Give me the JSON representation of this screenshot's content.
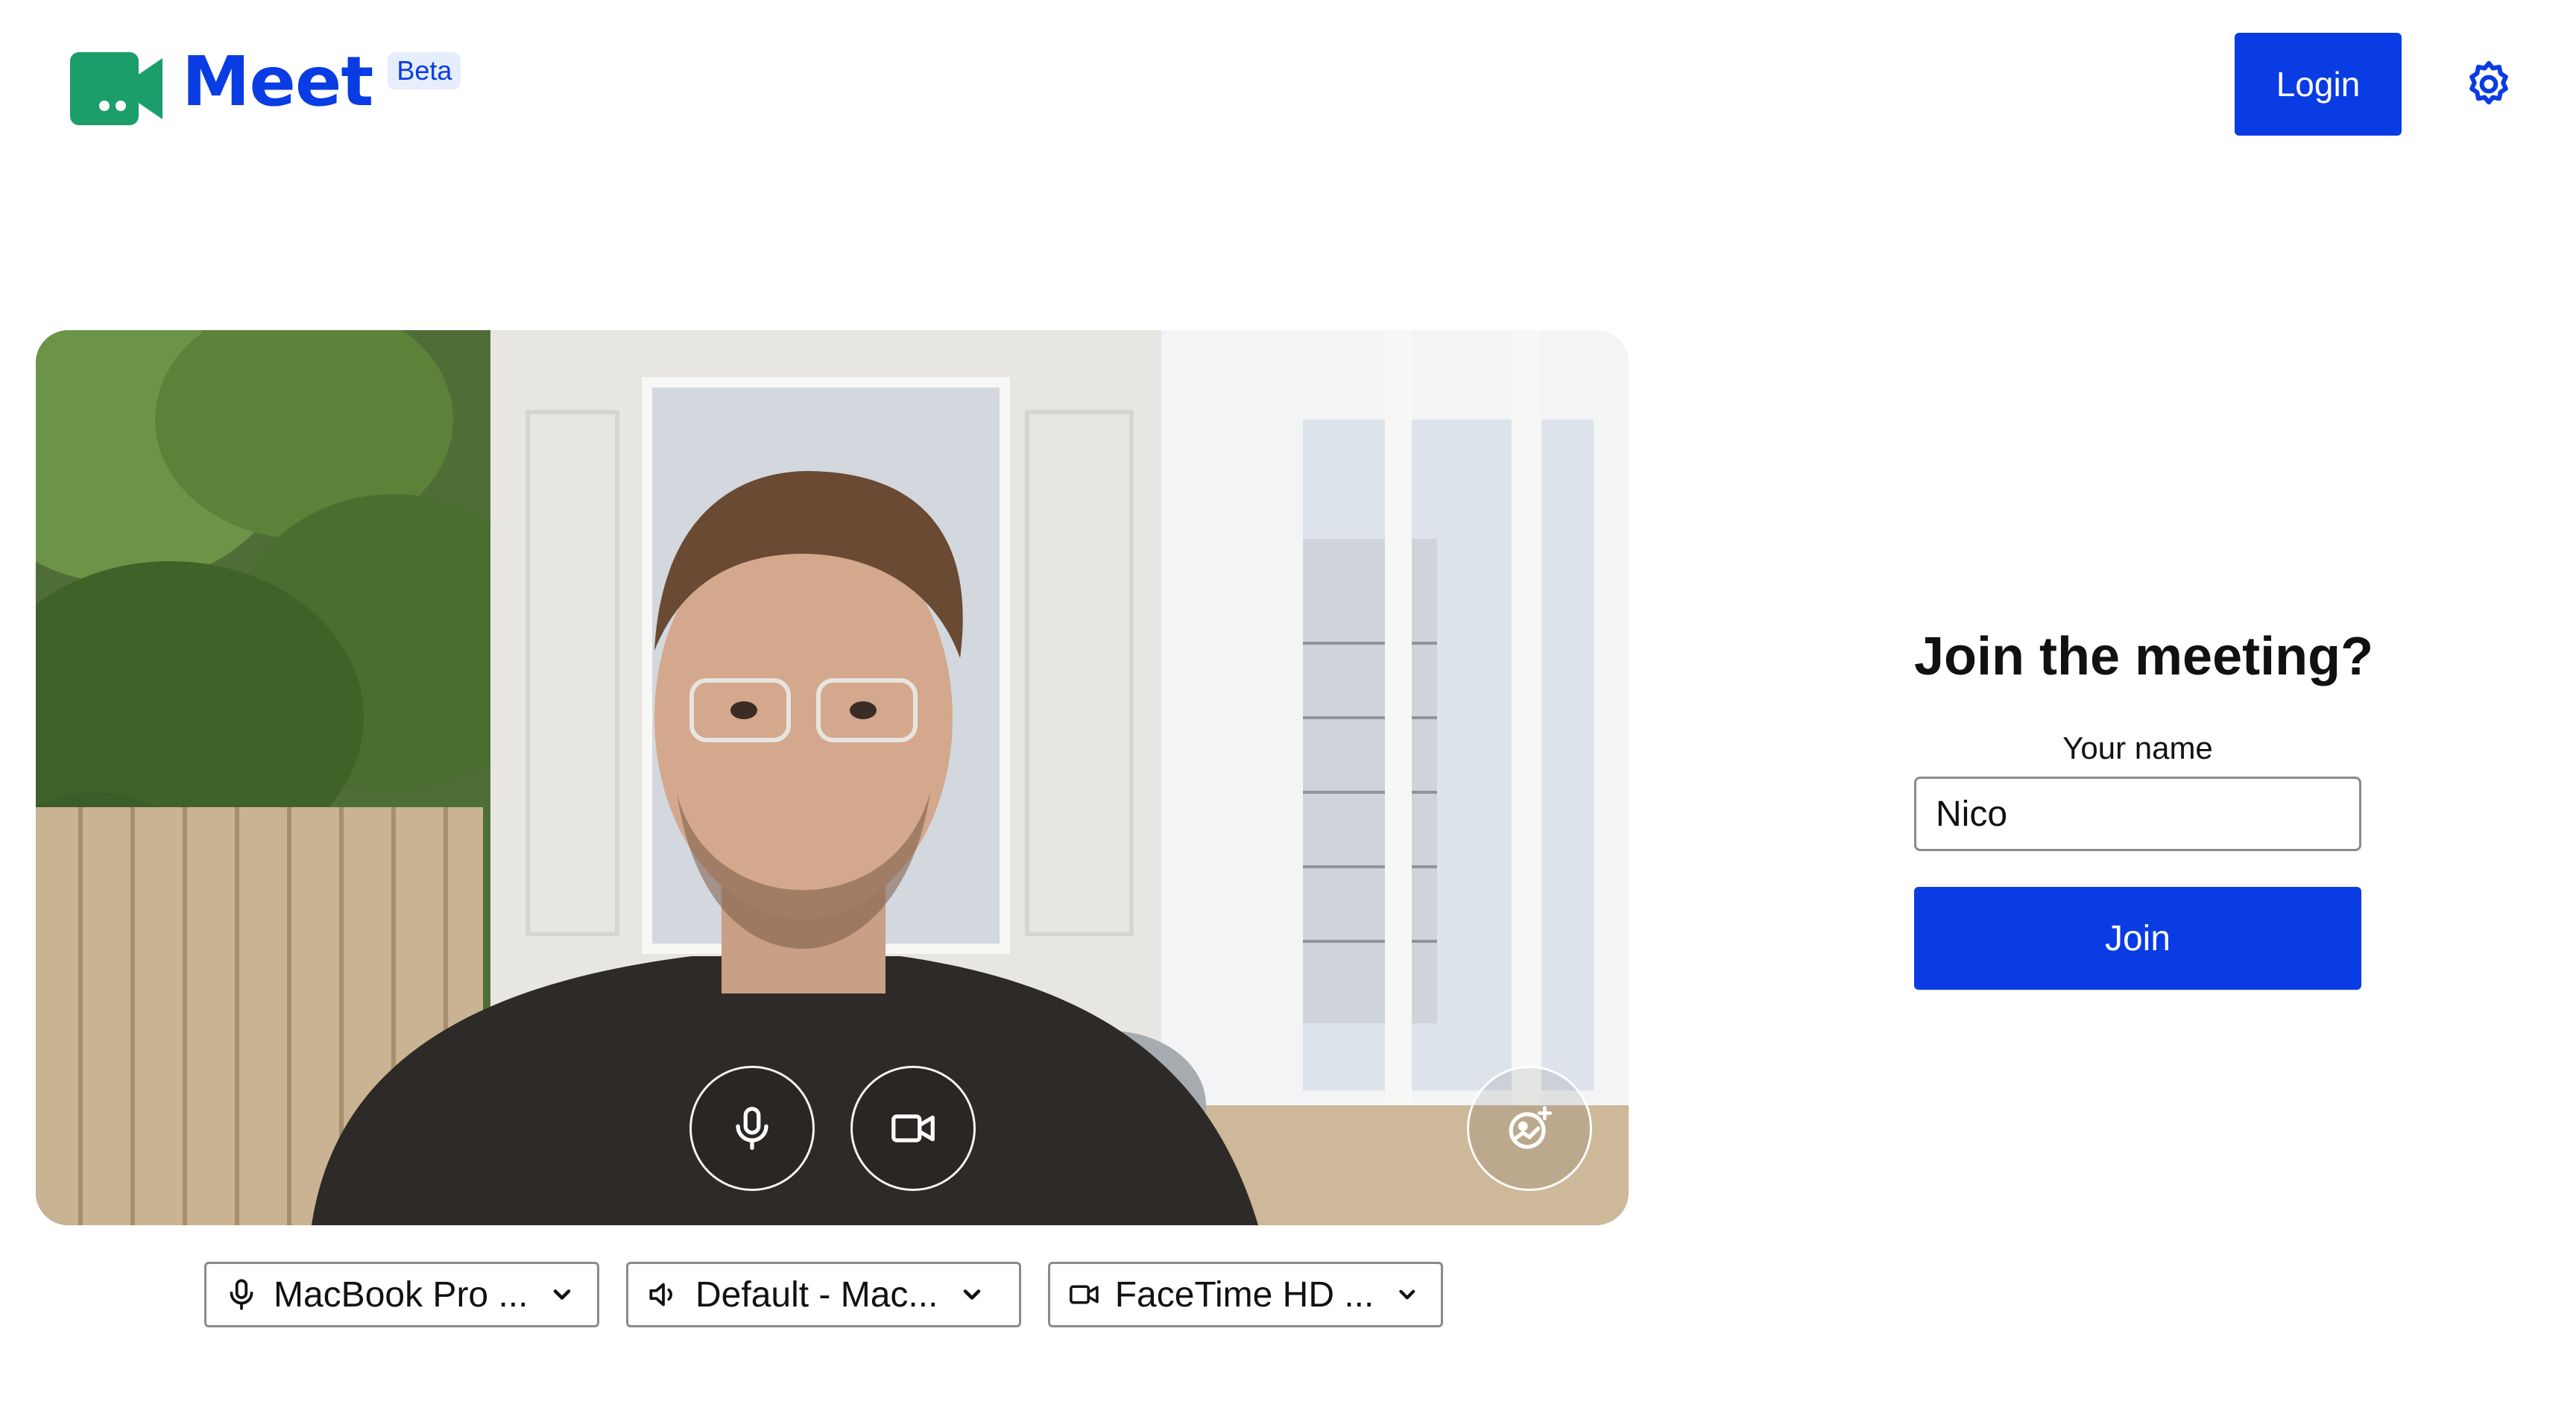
{
  "header": {
    "app_name": "Meet",
    "badge": "Beta",
    "login_label": "Login",
    "icons": {
      "logo": "video-camera-logo-icon",
      "settings": "gear-icon"
    }
  },
  "colors": {
    "brand_blue": "#0a3ce3",
    "logo_green": "#1c9e6a",
    "border_gray": "#8a8a8a"
  },
  "video_preview": {
    "controls": [
      {
        "name": "microphone-toggle",
        "icon": "microphone-icon"
      },
      {
        "name": "camera-toggle",
        "icon": "video-camera-icon"
      },
      {
        "name": "background-effects",
        "icon": "magic-effects-icon"
      }
    ]
  },
  "devices": {
    "microphone": {
      "label": "MacBook Pro ...",
      "icon": "microphone-icon"
    },
    "speaker": {
      "label": "Default - Mac...",
      "icon": "speaker-icon"
    },
    "camera": {
      "label": "FaceTime HD ...",
      "icon": "video-camera-icon"
    }
  },
  "join": {
    "title": "Join the meeting?",
    "name_label": "Your name",
    "name_value": "Nico",
    "join_label": "Join"
  }
}
